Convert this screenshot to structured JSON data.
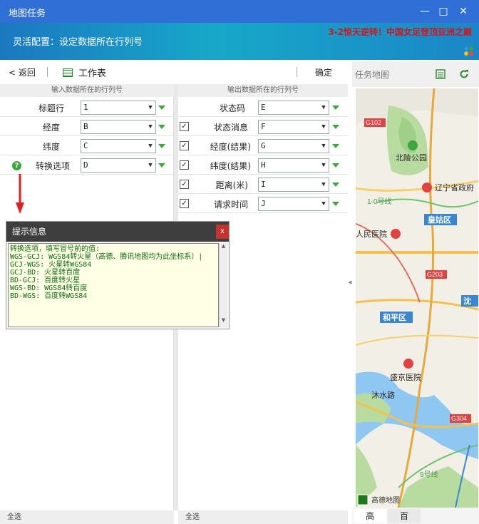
{
  "window": {
    "title": "地图任务",
    "minimize": "—",
    "maximize": "□",
    "close": "✕"
  },
  "banner": {
    "subtitle": "灵活配置：设定数据所在行列号",
    "news": "3-2惊天逆转！中国女足登顶亚洲之巅"
  },
  "toolbar": {
    "back": "< 返回",
    "sheet": "工作表",
    "confirm": "确定"
  },
  "left": {
    "header": "输入数据所在的行列号",
    "rows": [
      {
        "label": "标题行",
        "value": "1"
      },
      {
        "label": "经度",
        "value": "B"
      },
      {
        "label": "纬度",
        "value": "C"
      },
      {
        "label": "转换选项",
        "value": "D"
      }
    ],
    "footer": "全选"
  },
  "right": {
    "header": "输出数据所在的行列号",
    "rows": [
      {
        "label": "状态码",
        "value": "E",
        "checked": false
      },
      {
        "label": "状态消息",
        "value": "F",
        "checked": true
      },
      {
        "label": "经度(结果)",
        "value": "G",
        "checked": true
      },
      {
        "label": "纬度(结果)",
        "value": "H",
        "checked": true
      },
      {
        "label": "距离(米)",
        "value": "I",
        "checked": true
      },
      {
        "label": "请求时间",
        "value": "J",
        "checked": true
      }
    ],
    "footer": "全选"
  },
  "tooltip": {
    "title": "提示信息",
    "close": "x",
    "body": "转换选项，填写冒号前的值:\nWGS-GCJ: WGS84转火星（高德、腾讯地图均为此坐标系）|\nGCJ-WGS: 火星转WGS84\nGCJ-BD: 火星转百度\nBD-GCJ: 百度转火星\nWGS-BD: WGS84转百度\nBD-WGS: 百度转WGS84"
  },
  "map": {
    "title": "任务地图",
    "labels": {
      "g102": "G102",
      "park": "北陵公园",
      "gov": "辽宁省政府",
      "line1": "1-0号线",
      "station": "皇姑区",
      "hospital1": "人民医院",
      "g203": "G203",
      "shen": "沈",
      "heping": "和平区",
      "hospital2": "盛京医院",
      "road": "沐水路",
      "g304": "G304",
      "line9": "9号线",
      "provider": "高德地图"
    },
    "tabs": [
      "高",
      "百"
    ]
  },
  "colors": {
    "titlebar": "#2f6fd6",
    "accent": "#3aa83a",
    "news": "#d3151b"
  }
}
